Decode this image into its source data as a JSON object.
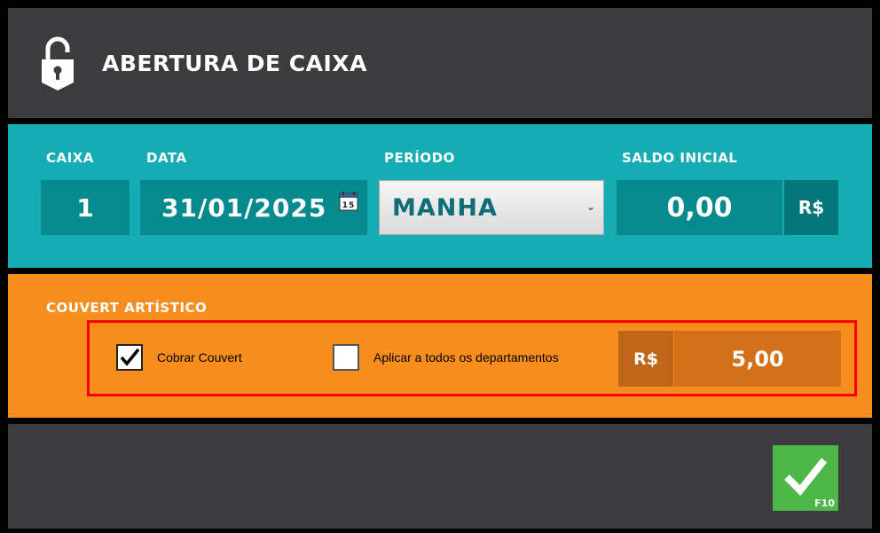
{
  "header": {
    "title": "ABERTURA DE CAIXA",
    "icon": "unlock-icon"
  },
  "caixa": {
    "caixa_label": "CAIXA",
    "caixa_value": "1",
    "data_label": "DATA",
    "data_value": "31/01/2025",
    "calendar_day": "15",
    "periodo_label": "PERÍODO",
    "periodo_value": "MANHA",
    "saldo_label": "SALDO INICIAL",
    "saldo_value": "0,00",
    "currency": "R$"
  },
  "couvert": {
    "section_label": "COUVERT ARTÍSTICO",
    "cobrar_label": "Cobrar Couvert",
    "cobrar_checked": true,
    "aplicar_label": "Aplicar a todos os departamentos",
    "aplicar_checked": false,
    "currency": "R$",
    "value": "5,00"
  },
  "footer": {
    "confirm_key": "F10",
    "confirm_icon": "checkmark-icon"
  },
  "colors": {
    "header_bg": "#3c3b3d",
    "caixa_bg": "#15adb3",
    "couvert_bg": "#f68e1f",
    "confirm_bg": "#4db848",
    "highlight": "#ff0000"
  }
}
